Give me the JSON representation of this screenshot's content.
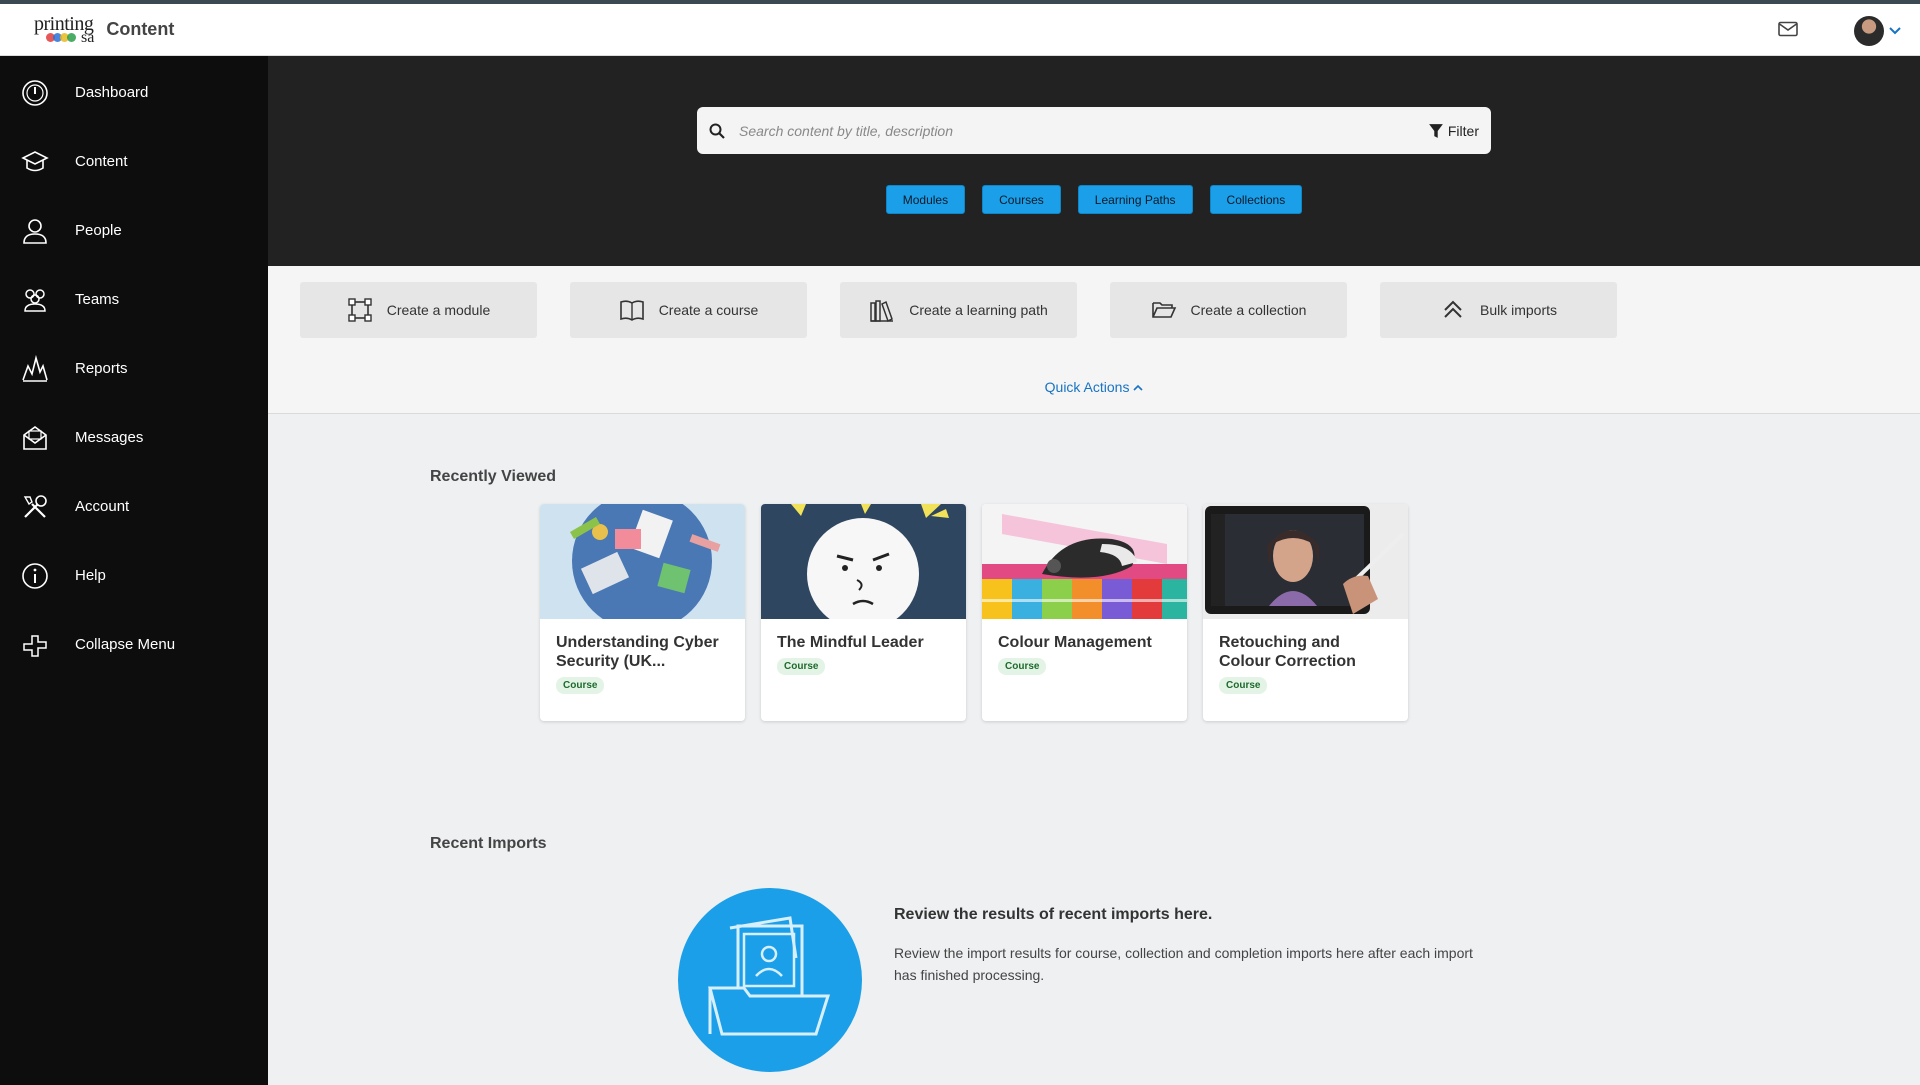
{
  "header": {
    "logo_line1": "printing",
    "logo_line2": "sa",
    "logo_dots": [
      "#e23b3b",
      "#2a6fd6",
      "#e6b820",
      "#2b9e4a"
    ],
    "app_title": "Content",
    "mail_icon": "envelope-icon",
    "avatar_menu_icon": "chevron-down-icon"
  },
  "sidebar": {
    "items": [
      {
        "label": "Dashboard",
        "icon": "dashboard-icon"
      },
      {
        "label": "Content",
        "icon": "graduation-cap-icon"
      },
      {
        "label": "People",
        "icon": "person-icon"
      },
      {
        "label": "Teams",
        "icon": "team-icon"
      },
      {
        "label": "Reports",
        "icon": "reports-icon"
      },
      {
        "label": "Messages",
        "icon": "envelope-open-icon"
      },
      {
        "label": "Account",
        "icon": "tools-icon"
      },
      {
        "label": "Help",
        "icon": "info-icon"
      },
      {
        "label": "Collapse Menu",
        "icon": "collapse-icon"
      }
    ]
  },
  "search": {
    "placeholder": "Search content by title, description",
    "value": "",
    "filter_label": "Filter"
  },
  "content_types": [
    "Modules",
    "Courses",
    "Learning Paths",
    "Collections"
  ],
  "quick_actions": {
    "items": [
      {
        "label": "Create a module",
        "icon": "module-icon"
      },
      {
        "label": "Create a course",
        "icon": "book-icon"
      },
      {
        "label": "Create a learning path",
        "icon": "library-icon"
      },
      {
        "label": "Create a collection",
        "icon": "folder-open-icon"
      },
      {
        "label": "Bulk imports",
        "icon": "double-chevron-up-icon"
      }
    ],
    "toggle_label": "Quick Actions"
  },
  "recently_viewed": {
    "title": "Recently Viewed",
    "cards": [
      {
        "title": "Understanding Cyber Security (UK...",
        "badge": "Course"
      },
      {
        "title": "The Mindful Leader",
        "badge": "Course"
      },
      {
        "title": "Colour Management",
        "badge": "Course"
      },
      {
        "title": "Retouching and Colour Correction",
        "badge": "Course"
      }
    ]
  },
  "recent_imports": {
    "title": "Recent Imports",
    "heading": "Review the results of recent imports here.",
    "text": "Review the import results for course, collection and completion imports here after each import has finished processing."
  },
  "colors": {
    "accent": "#1a9fe8",
    "sidebar_bg": "#0d0d0d",
    "hero_bg": "#222222",
    "link": "#1873c4"
  }
}
